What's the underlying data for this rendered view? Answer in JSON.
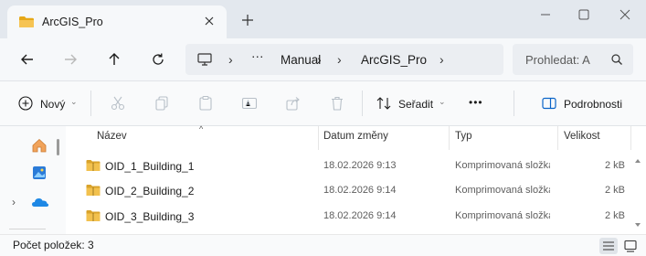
{
  "window": {
    "tab_title": "ArcGIS_Pro",
    "icons": [
      "folder-icon",
      "close-icon",
      "plus-icon",
      "minimize-icon",
      "maximize-icon",
      "close-window-icon"
    ]
  },
  "address": {
    "ellipsis": "···",
    "crumbs": [
      "Manual",
      "ArcGIS_Pro"
    ],
    "search_placeholder": "Prohledat: A"
  },
  "toolbar": {
    "new_label": "Nový",
    "sort_label": "Seřadit",
    "more_label": "•••",
    "details_label": "Podrobnosti"
  },
  "list": {
    "headers": {
      "name": "Název",
      "date": "Datum změny",
      "type": "Typ",
      "size": "Velikost"
    },
    "rows": [
      {
        "name": "OID_1_Building_1",
        "date": "18.02.2026 9:13",
        "type": "Komprimovaná složka (zip)",
        "size": "2 kB"
      },
      {
        "name": "OID_2_Building_2",
        "date": "18.02.2026 9:14",
        "type": "Komprimovaná složka (zip)",
        "size": "2 kB"
      },
      {
        "name": "OID_3_Building_3",
        "date": "18.02.2026 9:14",
        "type": "Komprimovaná složka (zip)",
        "size": "2 kB"
      }
    ]
  },
  "status": {
    "count": "Počet položek: 3"
  },
  "colors": {
    "folder_yellow": "#f2c14e",
    "folder_dark": "#d9a32b",
    "accent_blue": "#0a64c8",
    "onedrive_blue": "#1e88e5"
  }
}
